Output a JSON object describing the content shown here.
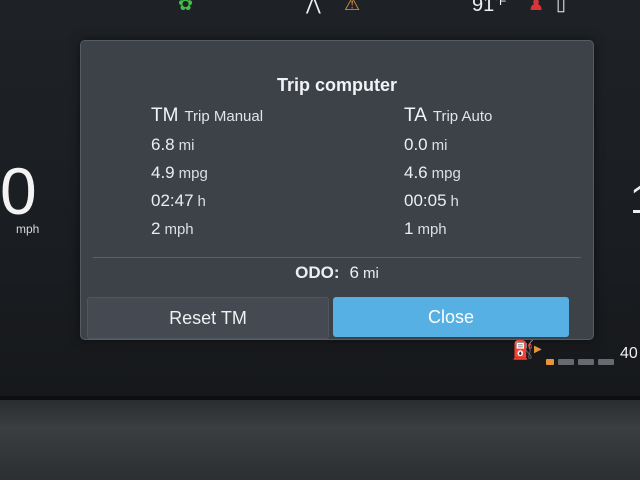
{
  "status": {
    "temperature": "91",
    "temperature_unit": "°F"
  },
  "speedometer": {
    "value": "0",
    "unit": "mph"
  },
  "right_gauge_partial": "1",
  "dialog": {
    "title": "Trip computer",
    "trip_manual": {
      "abbr": "TM",
      "name": "Trip Manual",
      "distance": "6.8",
      "distance_unit": "mi",
      "economy": "4.9",
      "economy_unit": "mpg",
      "time": "02:47",
      "time_unit": "h",
      "speed": "2",
      "speed_unit": "mph"
    },
    "trip_auto": {
      "abbr": "TA",
      "name": "Trip Auto",
      "distance": "0.0",
      "distance_unit": "mi",
      "economy": "4.6",
      "economy_unit": "mpg",
      "time": "00:05",
      "time_unit": "h",
      "speed": "1",
      "speed_unit": "mph"
    },
    "odo": {
      "label": "ODO:",
      "value": "6",
      "unit": "mi"
    },
    "reset_label": "Reset TM",
    "close_label": "Close"
  },
  "fuel": {
    "range": "40",
    "level_fraction": 0.1,
    "accent": "#e8953a"
  },
  "colors": {
    "close_button": "#56b0e4",
    "dialog_bg": "#3d4249",
    "warning": "#e8953a",
    "alert": "#d9343a",
    "eco": "#3fbf4a"
  }
}
